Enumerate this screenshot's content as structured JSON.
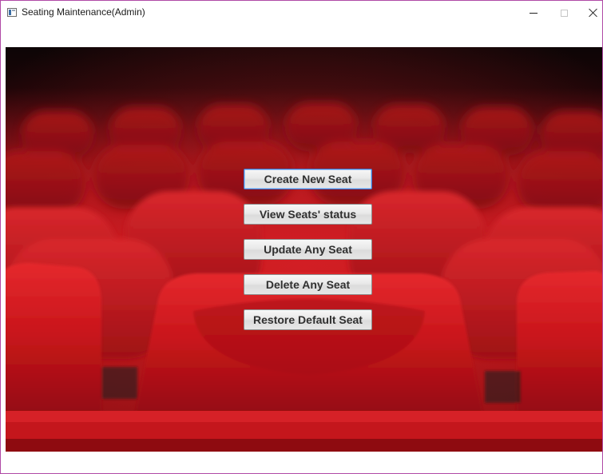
{
  "window": {
    "title": "Seating Maintenance(Admin)",
    "icon": "app-window-icon",
    "controls": {
      "minimize": "minimize-icon",
      "maximize": "maximize-icon",
      "close": "close-icon"
    }
  },
  "background": {
    "subject": "red-theater-seats",
    "colors": {
      "seat_red": "#c4161c",
      "shadow": "#0d0506"
    }
  },
  "menu": {
    "buttons": [
      {
        "label": "Create New Seat",
        "focused": true
      },
      {
        "label": "View Seats' status",
        "focused": false
      },
      {
        "label": "Update Any Seat",
        "focused": false
      },
      {
        "label": "Delete Any Seat",
        "focused": false
      },
      {
        "label": "Restore Default Seat",
        "focused": false
      }
    ]
  },
  "colors": {
    "focus_border": "#3a7bd5",
    "window_border": "#b04aa6"
  }
}
